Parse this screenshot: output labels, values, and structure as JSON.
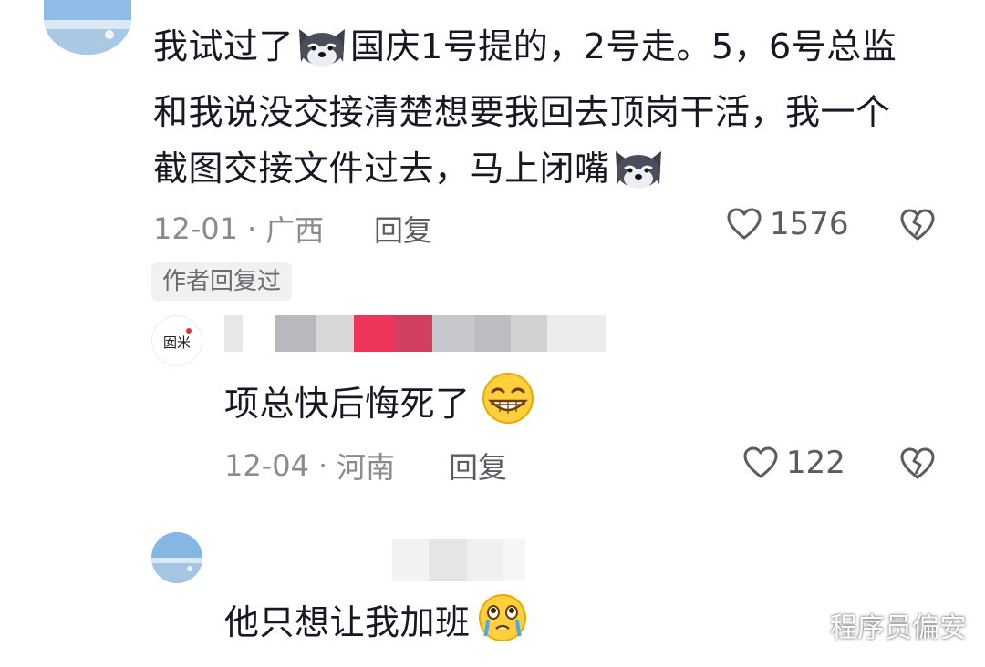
{
  "comments": [
    {
      "text_lines": [
        "我试过了",
        "国庆1号提的，2号走。5，6号总监",
        "和我说没交接清楚想要我回去顶岗干活，我一个",
        "截图交接文件过去，马上闭嘴"
      ],
      "date": "12-01",
      "location": "广西",
      "reply_label": "回复",
      "likes": "1576",
      "author_tag": "作者回复过"
    },
    {
      "text": "项总快后悔死了",
      "date": "12-04",
      "location": "河南",
      "reply_label": "回复",
      "likes": "122"
    },
    {
      "text": "他只想让我加班"
    }
  ],
  "separator": "·",
  "avatar_art_glyph": "囡米",
  "watermark": "程序员偏安",
  "colors": {
    "text": "#161823",
    "meta": "#8a8b91",
    "tag_bg": "#f1f1f2",
    "redact_pink": "#f0355a",
    "redact_gray": "#c8c8cc"
  },
  "icons": [
    "husky-emoji",
    "grin-emoji",
    "teary-emoji",
    "heart-icon",
    "broken-heart-icon",
    "wechat-icon"
  ]
}
